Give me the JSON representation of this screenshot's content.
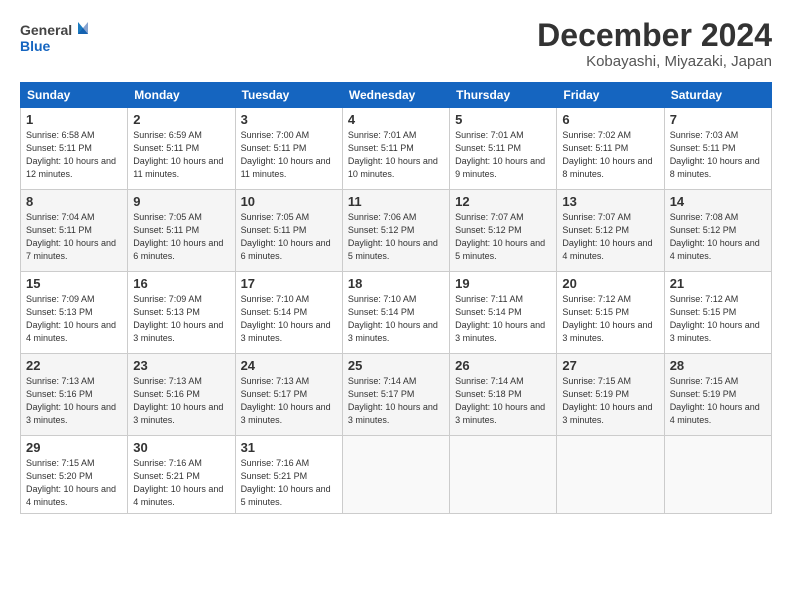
{
  "logo": {
    "text_general": "General",
    "text_blue": "Blue"
  },
  "header": {
    "month": "December 2024",
    "location": "Kobayashi, Miyazaki, Japan"
  },
  "weekdays": [
    "Sunday",
    "Monday",
    "Tuesday",
    "Wednesday",
    "Thursday",
    "Friday",
    "Saturday"
  ],
  "weeks": [
    [
      {
        "day": "1",
        "sunrise": "Sunrise: 6:58 AM",
        "sunset": "Sunset: 5:11 PM",
        "daylight": "Daylight: 10 hours and 12 minutes."
      },
      {
        "day": "2",
        "sunrise": "Sunrise: 6:59 AM",
        "sunset": "Sunset: 5:11 PM",
        "daylight": "Daylight: 10 hours and 11 minutes."
      },
      {
        "day": "3",
        "sunrise": "Sunrise: 7:00 AM",
        "sunset": "Sunset: 5:11 PM",
        "daylight": "Daylight: 10 hours and 11 minutes."
      },
      {
        "day": "4",
        "sunrise": "Sunrise: 7:01 AM",
        "sunset": "Sunset: 5:11 PM",
        "daylight": "Daylight: 10 hours and 10 minutes."
      },
      {
        "day": "5",
        "sunrise": "Sunrise: 7:01 AM",
        "sunset": "Sunset: 5:11 PM",
        "daylight": "Daylight: 10 hours and 9 minutes."
      },
      {
        "day": "6",
        "sunrise": "Sunrise: 7:02 AM",
        "sunset": "Sunset: 5:11 PM",
        "daylight": "Daylight: 10 hours and 8 minutes."
      },
      {
        "day": "7",
        "sunrise": "Sunrise: 7:03 AM",
        "sunset": "Sunset: 5:11 PM",
        "daylight": "Daylight: 10 hours and 8 minutes."
      }
    ],
    [
      {
        "day": "8",
        "sunrise": "Sunrise: 7:04 AM",
        "sunset": "Sunset: 5:11 PM",
        "daylight": "Daylight: 10 hours and 7 minutes."
      },
      {
        "day": "9",
        "sunrise": "Sunrise: 7:05 AM",
        "sunset": "Sunset: 5:11 PM",
        "daylight": "Daylight: 10 hours and 6 minutes."
      },
      {
        "day": "10",
        "sunrise": "Sunrise: 7:05 AM",
        "sunset": "Sunset: 5:11 PM",
        "daylight": "Daylight: 10 hours and 6 minutes."
      },
      {
        "day": "11",
        "sunrise": "Sunrise: 7:06 AM",
        "sunset": "Sunset: 5:12 PM",
        "daylight": "Daylight: 10 hours and 5 minutes."
      },
      {
        "day": "12",
        "sunrise": "Sunrise: 7:07 AM",
        "sunset": "Sunset: 5:12 PM",
        "daylight": "Daylight: 10 hours and 5 minutes."
      },
      {
        "day": "13",
        "sunrise": "Sunrise: 7:07 AM",
        "sunset": "Sunset: 5:12 PM",
        "daylight": "Daylight: 10 hours and 4 minutes."
      },
      {
        "day": "14",
        "sunrise": "Sunrise: 7:08 AM",
        "sunset": "Sunset: 5:12 PM",
        "daylight": "Daylight: 10 hours and 4 minutes."
      }
    ],
    [
      {
        "day": "15",
        "sunrise": "Sunrise: 7:09 AM",
        "sunset": "Sunset: 5:13 PM",
        "daylight": "Daylight: 10 hours and 4 minutes."
      },
      {
        "day": "16",
        "sunrise": "Sunrise: 7:09 AM",
        "sunset": "Sunset: 5:13 PM",
        "daylight": "Daylight: 10 hours and 3 minutes."
      },
      {
        "day": "17",
        "sunrise": "Sunrise: 7:10 AM",
        "sunset": "Sunset: 5:14 PM",
        "daylight": "Daylight: 10 hours and 3 minutes."
      },
      {
        "day": "18",
        "sunrise": "Sunrise: 7:10 AM",
        "sunset": "Sunset: 5:14 PM",
        "daylight": "Daylight: 10 hours and 3 minutes."
      },
      {
        "day": "19",
        "sunrise": "Sunrise: 7:11 AM",
        "sunset": "Sunset: 5:14 PM",
        "daylight": "Daylight: 10 hours and 3 minutes."
      },
      {
        "day": "20",
        "sunrise": "Sunrise: 7:12 AM",
        "sunset": "Sunset: 5:15 PM",
        "daylight": "Daylight: 10 hours and 3 minutes."
      },
      {
        "day": "21",
        "sunrise": "Sunrise: 7:12 AM",
        "sunset": "Sunset: 5:15 PM",
        "daylight": "Daylight: 10 hours and 3 minutes."
      }
    ],
    [
      {
        "day": "22",
        "sunrise": "Sunrise: 7:13 AM",
        "sunset": "Sunset: 5:16 PM",
        "daylight": "Daylight: 10 hours and 3 minutes."
      },
      {
        "day": "23",
        "sunrise": "Sunrise: 7:13 AM",
        "sunset": "Sunset: 5:16 PM",
        "daylight": "Daylight: 10 hours and 3 minutes."
      },
      {
        "day": "24",
        "sunrise": "Sunrise: 7:13 AM",
        "sunset": "Sunset: 5:17 PM",
        "daylight": "Daylight: 10 hours and 3 minutes."
      },
      {
        "day": "25",
        "sunrise": "Sunrise: 7:14 AM",
        "sunset": "Sunset: 5:17 PM",
        "daylight": "Daylight: 10 hours and 3 minutes."
      },
      {
        "day": "26",
        "sunrise": "Sunrise: 7:14 AM",
        "sunset": "Sunset: 5:18 PM",
        "daylight": "Daylight: 10 hours and 3 minutes."
      },
      {
        "day": "27",
        "sunrise": "Sunrise: 7:15 AM",
        "sunset": "Sunset: 5:19 PM",
        "daylight": "Daylight: 10 hours and 3 minutes."
      },
      {
        "day": "28",
        "sunrise": "Sunrise: 7:15 AM",
        "sunset": "Sunset: 5:19 PM",
        "daylight": "Daylight: 10 hours and 4 minutes."
      }
    ],
    [
      {
        "day": "29",
        "sunrise": "Sunrise: 7:15 AM",
        "sunset": "Sunset: 5:20 PM",
        "daylight": "Daylight: 10 hours and 4 minutes."
      },
      {
        "day": "30",
        "sunrise": "Sunrise: 7:16 AM",
        "sunset": "Sunset: 5:21 PM",
        "daylight": "Daylight: 10 hours and 4 minutes."
      },
      {
        "day": "31",
        "sunrise": "Sunrise: 7:16 AM",
        "sunset": "Sunset: 5:21 PM",
        "daylight": "Daylight: 10 hours and 5 minutes."
      },
      null,
      null,
      null,
      null
    ]
  ]
}
